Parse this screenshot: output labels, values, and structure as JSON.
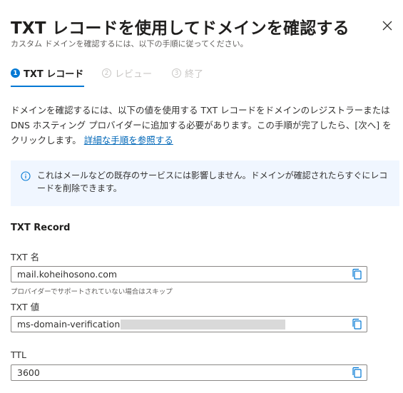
{
  "dialog": {
    "title": "TXT レコードを使用してドメインを確認する",
    "subtitle": "カスタム ドメインを確認するには、以下の手順に従ってください。",
    "close_icon": "close-icon"
  },
  "steps": [
    {
      "num": "1",
      "label": "TXT レコード",
      "state": "active"
    },
    {
      "num": "2",
      "label": "レビュー",
      "state": "inactive"
    },
    {
      "num": "3",
      "label": "終了",
      "state": "inactive"
    }
  ],
  "description": {
    "text": "ドメインを確認するには、以下の値を使用する TXT レコードをドメインのレジストラーまたは DNS ホスティング プロバイダーに追加する必要があります。この手順が完了したら、[次へ] をクリックします。",
    "link": "詳細な手順を参照する"
  },
  "info": {
    "icon": "info-icon",
    "text": "これはメールなどの既存のサービスには影響しません。ドメインが確認されたらすぐにレコードを削除できます。"
  },
  "record": {
    "section_title": "TXT Record",
    "name_label": "TXT 名",
    "name_value": "mail.koheihosono.com",
    "name_hint": "プロバイダーでサポートされていない場合はスキップ",
    "value_label": "TXT 値",
    "value_value": "ms-domain-verification=",
    "ttl_label": "TTL",
    "ttl_value": "3600"
  },
  "colors": {
    "accent": "#0078d4",
    "link": "#0067b8",
    "info_bg": "#f0f6ff"
  }
}
